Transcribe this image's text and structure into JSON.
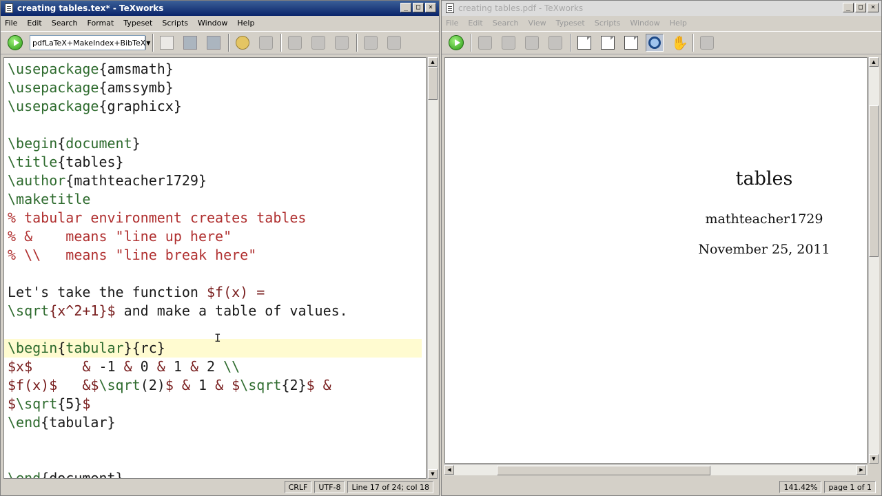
{
  "editor": {
    "title": "creating tables.tex* - TeXworks",
    "menu": [
      "File",
      "Edit",
      "Search",
      "Format",
      "Typeset",
      "Scripts",
      "Window",
      "Help"
    ],
    "engine": "pdfLaTeX+MakeIndex+BibTeX",
    "code_lines": [
      [
        [
          "cmd",
          "\\usepackage"
        ],
        [
          "br",
          "{amsmath}"
        ]
      ],
      [
        [
          "cmd",
          "\\usepackage"
        ],
        [
          "br",
          "{amssymb}"
        ]
      ],
      [
        [
          "cmd",
          "\\usepackage"
        ],
        [
          "br",
          "{graphicx}"
        ]
      ],
      [],
      [
        [
          "cmd",
          "\\begin"
        ],
        [
          "br",
          "{"
        ],
        [
          "cmd",
          "document"
        ],
        [
          "br",
          "}"
        ]
      ],
      [
        [
          "cmd",
          "\\title"
        ],
        [
          "br",
          "{tables}"
        ]
      ],
      [
        [
          "cmd",
          "\\author"
        ],
        [
          "br",
          "{mathteacher1729}"
        ]
      ],
      [
        [
          "cmd",
          "\\maketitle"
        ]
      ],
      [
        [
          "cmt",
          "% tabular environment creates tables"
        ]
      ],
      [
        [
          "cmt",
          "% &    means \"line up here\""
        ]
      ],
      [
        [
          "cmt",
          "% \\\\   means \"line break here\""
        ]
      ],
      [],
      [
        [
          "br",
          "Let's take the function "
        ],
        [
          "mth",
          "$f(x) ="
        ]
      ],
      [
        [
          "cmd",
          "\\sqrt"
        ],
        [
          "mth",
          "{x^2+1}$"
        ],
        [
          "br",
          " and make a table of values."
        ]
      ],
      [],
      [
        [
          "cmd",
          "\\begin"
        ],
        [
          "br",
          "{"
        ],
        [
          "cmd",
          "tabular"
        ],
        [
          "br",
          "}{rc}"
        ]
      ],
      [
        [
          "mth",
          "$x$"
        ],
        [
          "br",
          "      "
        ],
        [
          "amp",
          "&"
        ],
        [
          "br",
          " -1 "
        ],
        [
          "amp",
          "&"
        ],
        [
          "br",
          " 0 "
        ],
        [
          "amp",
          "&"
        ],
        [
          "br",
          " 1 "
        ],
        [
          "amp",
          "&"
        ],
        [
          "br",
          " 2 "
        ],
        [
          "cmd",
          "\\\\"
        ]
      ],
      [
        [
          "mth",
          "$f(x)$"
        ],
        [
          "br",
          "   "
        ],
        [
          "amp",
          "&"
        ],
        [
          "mth",
          "$"
        ],
        [
          "cmd",
          "\\sqrt"
        ],
        [
          "br",
          "(2)"
        ],
        [
          "mth",
          "$"
        ],
        [
          "br",
          " "
        ],
        [
          "amp",
          "&"
        ],
        [
          "br",
          " 1 "
        ],
        [
          "amp",
          "&"
        ],
        [
          "br",
          " "
        ],
        [
          "mth",
          "$"
        ],
        [
          "cmd",
          "\\sqrt"
        ],
        [
          "br",
          "{2}"
        ],
        [
          "mth",
          "$"
        ],
        [
          "br",
          " "
        ],
        [
          "amp",
          "&"
        ]
      ],
      [
        [
          "mth",
          "$"
        ],
        [
          "cmd",
          "\\sqrt"
        ],
        [
          "br",
          "{5}"
        ],
        [
          "mth",
          "$"
        ]
      ],
      [
        [
          "cmd",
          "\\end"
        ],
        [
          "br",
          "{tabular}"
        ]
      ],
      [],
      [],
      [
        [
          "cmd",
          "\\end"
        ],
        [
          "br",
          "{document}"
        ]
      ]
    ],
    "current_line": 15,
    "status": {
      "eol": "CRLF",
      "encoding": "UTF-8",
      "position": "Line 17 of 24; col 18"
    }
  },
  "preview": {
    "title": "creating tables.pdf - TeXworks",
    "menu": [
      "File",
      "Edit",
      "Search",
      "View",
      "Typeset",
      "Scripts",
      "Window",
      "Help"
    ],
    "doc_title": "tables",
    "doc_author": "mathteacher1729",
    "doc_date": "November 25, 2011",
    "status": {
      "zoom": "141.42%",
      "page": "page 1 of 1"
    }
  }
}
